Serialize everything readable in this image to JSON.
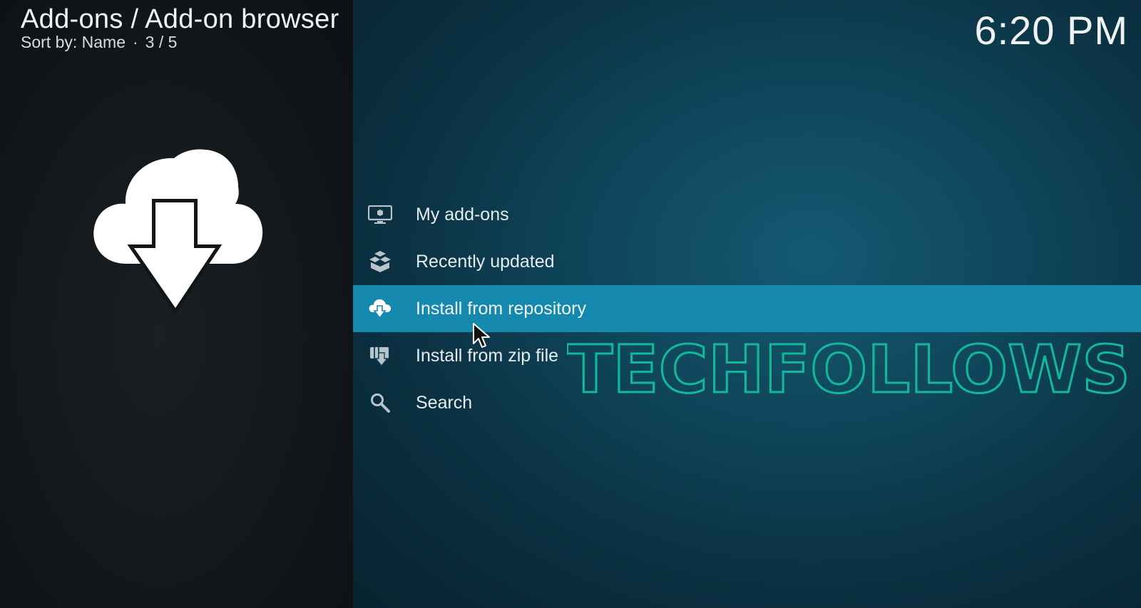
{
  "header": {
    "breadcrumb": "Add-ons / Add-on browser",
    "sort_label": "Sort by: Name",
    "separator": "·",
    "position": "3 / 5"
  },
  "clock": "6:20 PM",
  "preview_icon": "cloud-download-icon",
  "menu": {
    "items": [
      {
        "label": "My add-ons",
        "icon": "monitor-box-icon"
      },
      {
        "label": "Recently updated",
        "icon": "boxes-icon"
      },
      {
        "label": "Install from repository",
        "icon": "cloud-download-icon",
        "selected": true
      },
      {
        "label": "Install from zip file",
        "icon": "zip-install-icon"
      },
      {
        "label": "Search",
        "icon": "search-icon"
      }
    ]
  },
  "watermark": "TECHFOLLOWS",
  "colors": {
    "highlight": "#1488ad",
    "watermark": "#12b89a",
    "left_bg": "#111517",
    "right_bg": "#0f455a"
  }
}
